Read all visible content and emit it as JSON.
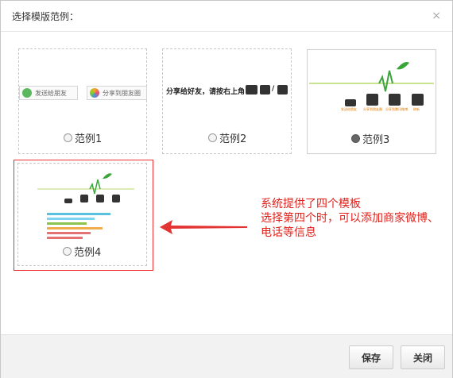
{
  "dialog": {
    "title": "选择模版范例：",
    "close_symbol": "×"
  },
  "templates": [
    {
      "label": "范例1",
      "selected": false,
      "preview": {
        "share_friend": "发送给朋友",
        "share_moments": "分享到朋友圈"
      }
    },
    {
      "label": "范例2",
      "selected": false,
      "preview": {
        "hint": "分享给好友，请按右上角"
      }
    },
    {
      "label": "范例3",
      "selected": true,
      "preview": {
        "icon_captions": [
          "发送给朋友",
          "分享到朋友圈",
          "分享到腾讯微博",
          "刷新"
        ]
      }
    },
    {
      "label": "范例4",
      "selected": false
    }
  ],
  "annotation": {
    "line1": "系统提供了四个模板",
    "line2": "选择第四个时，可以添加商家微博、电话等信息"
  },
  "footer": {
    "save_label": "保存",
    "close_label": "关闭"
  },
  "colors": {
    "accent_red": "#e33333",
    "logo_green": "#3aa63a",
    "caption_orange": "#e07b00"
  }
}
